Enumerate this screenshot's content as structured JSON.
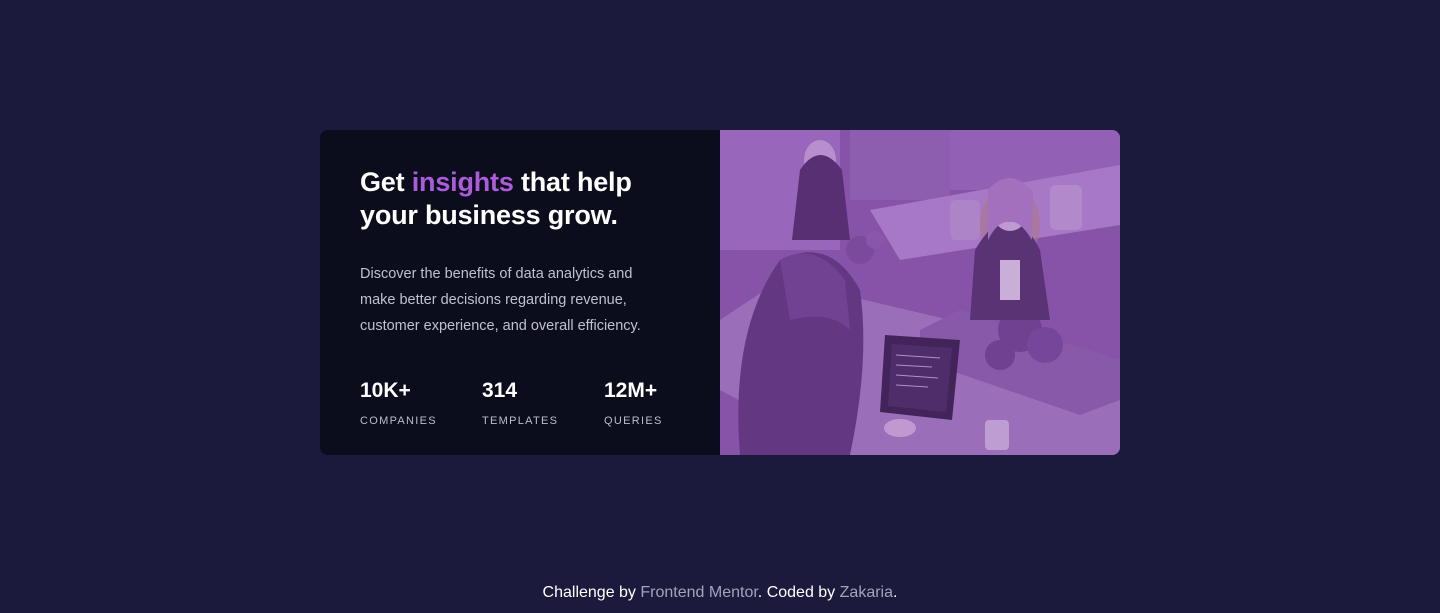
{
  "card": {
    "headline_before": "Get",
    "headline_accent": "insights",
    "headline_after": "that help your business grow.",
    "description": "Discover the benefits of data analytics and make better decisions regarding revenue, customer experience, and overall efficiency.",
    "stats": [
      {
        "value": "10K+",
        "label": "COMPANIES"
      },
      {
        "value": "314",
        "label": "TEMPLATES"
      },
      {
        "value": "12M+",
        "label": "QUERIES"
      }
    ],
    "image_tint": "#7d4a9e"
  },
  "attribution": {
    "prefix": "Challenge by",
    "link1": "Frontend Mentor",
    "middle": ". Coded by",
    "link2": "Zakaria",
    "suffix": "."
  },
  "colors": {
    "page_background": "#1c1a3c",
    "card_background": "#0b0c1c",
    "accent": "#ab5cdb",
    "link_muted": "#a5a2bd"
  }
}
